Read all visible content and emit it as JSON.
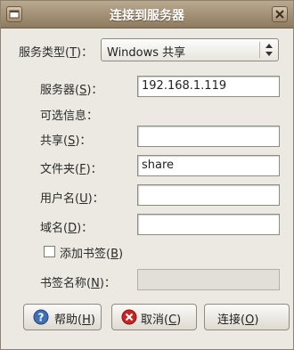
{
  "window": {
    "title": "连接到服务器"
  },
  "form": {
    "service_type_label": "服务类型(",
    "service_type_key": "T",
    "service_type_suffix": ")：",
    "service_type_value": "Windows 共享",
    "server_label": "服务器(",
    "server_key": "S",
    "server_suffix": ")：",
    "server_value": "192.168.1.119",
    "optional_info": "可选信息：",
    "share_label": "共享(",
    "share_key": "S",
    "share_suffix": ")：",
    "share_value": "",
    "folder_label": "文件夹(",
    "folder_key": "F",
    "folder_suffix": ")：",
    "folder_value": "share",
    "username_label": "用户名(",
    "username_key": "U",
    "username_suffix": ")：",
    "username_value": "",
    "domain_label": "域名(",
    "domain_key": "D",
    "domain_suffix": ")：",
    "domain_value": "",
    "bookmark_check_label": "添加书签(",
    "bookmark_check_key": "B",
    "bookmark_check_suffix": ")",
    "bookmark_checked": false,
    "bookmark_name_label": "书签名称(",
    "bookmark_name_key": "N",
    "bookmark_name_suffix": ")：",
    "bookmark_name_value": ""
  },
  "buttons": {
    "help_label": "帮助(",
    "help_key": "H",
    "help_suffix": ")",
    "cancel_label": "取消(",
    "cancel_key": "C",
    "cancel_suffix": ")",
    "connect_label": "连接(",
    "connect_key": "O",
    "connect_suffix": ")"
  },
  "icons": {
    "menu": "window-menu-icon",
    "close": "close-icon",
    "combo_arrows": "updown-arrows-icon",
    "help": "help-icon",
    "cancel": "cancel-icon"
  },
  "colors": {
    "titlebar": "#8e7b5f",
    "help_icon": "#3f6fb5",
    "cancel_icon": "#cc2222"
  }
}
